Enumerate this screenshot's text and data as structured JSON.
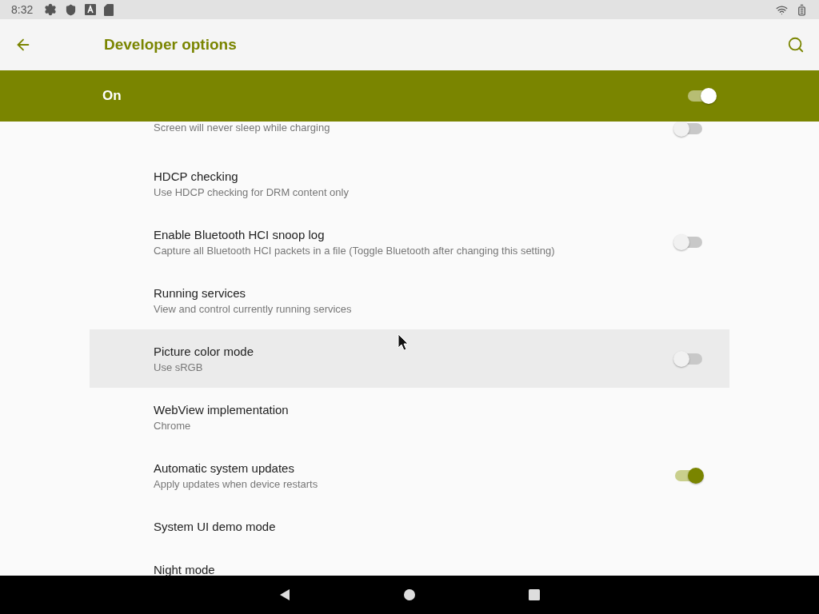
{
  "status_bar": {
    "time": "8:32"
  },
  "toolbar": {
    "title": "Developer options"
  },
  "master_switch": {
    "label": "On",
    "on": true
  },
  "settings": [
    {
      "subtitle": "Screen will never sleep while charging",
      "kind": "toggle",
      "on": false,
      "focused": false
    },
    {
      "title": "HDCP checking",
      "subtitle": "Use HDCP checking for DRM content only",
      "kind": "plain",
      "focused": false
    },
    {
      "title": "Enable Bluetooth HCI snoop log",
      "subtitle": "Capture all Bluetooth HCI packets in a file (Toggle Bluetooth after changing this setting)",
      "kind": "toggle",
      "on": false,
      "focused": false
    },
    {
      "title": "Running services",
      "subtitle": "View and control currently running services",
      "kind": "plain",
      "focused": false
    },
    {
      "title": "Picture color mode",
      "subtitle": "Use sRGB",
      "kind": "toggle",
      "on": false,
      "focused": true
    },
    {
      "title": "WebView implementation",
      "subtitle": "Chrome",
      "kind": "plain",
      "focused": false
    },
    {
      "title": "Automatic system updates",
      "subtitle": "Apply updates when device restarts",
      "kind": "toggle",
      "on": true,
      "focused": false
    },
    {
      "title": "System UI demo mode",
      "kind": "plain",
      "focused": false
    },
    {
      "title": "Night mode",
      "kind": "plain",
      "focused": false
    }
  ]
}
